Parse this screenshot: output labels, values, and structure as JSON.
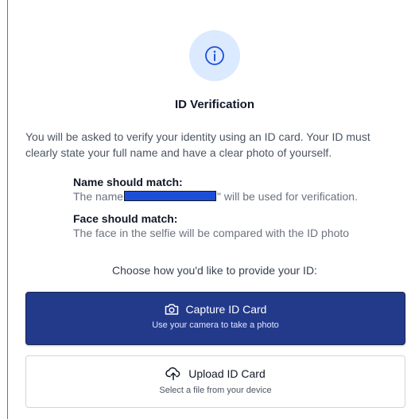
{
  "header": {
    "title": "ID Verification",
    "icon": "info-icon"
  },
  "intro": "You will be asked to verify your identity using an ID card. Your ID must clearly state your full name and have a clear photo of yourself.",
  "requirements": [
    {
      "title": "Name should match:",
      "text_before": "The name",
      "text_after": "\" will be used for verification."
    },
    {
      "title": "Face should match:",
      "text": "The face in the selfie will be compared with the ID photo"
    }
  ],
  "choose_prompt": "Choose how you'd like to provide your ID:",
  "options": [
    {
      "label": "Capture ID Card",
      "description": "Use your camera to take a photo",
      "icon": "camera-icon"
    },
    {
      "label": "Upload ID Card",
      "description": "Select a file from your device",
      "icon": "cloud-upload-icon"
    }
  ],
  "colors": {
    "primary": "#233a8b",
    "badge_bg": "#dbeafe",
    "badge_icon": "#1d4ed8",
    "redaction": "#1d4ed8"
  }
}
